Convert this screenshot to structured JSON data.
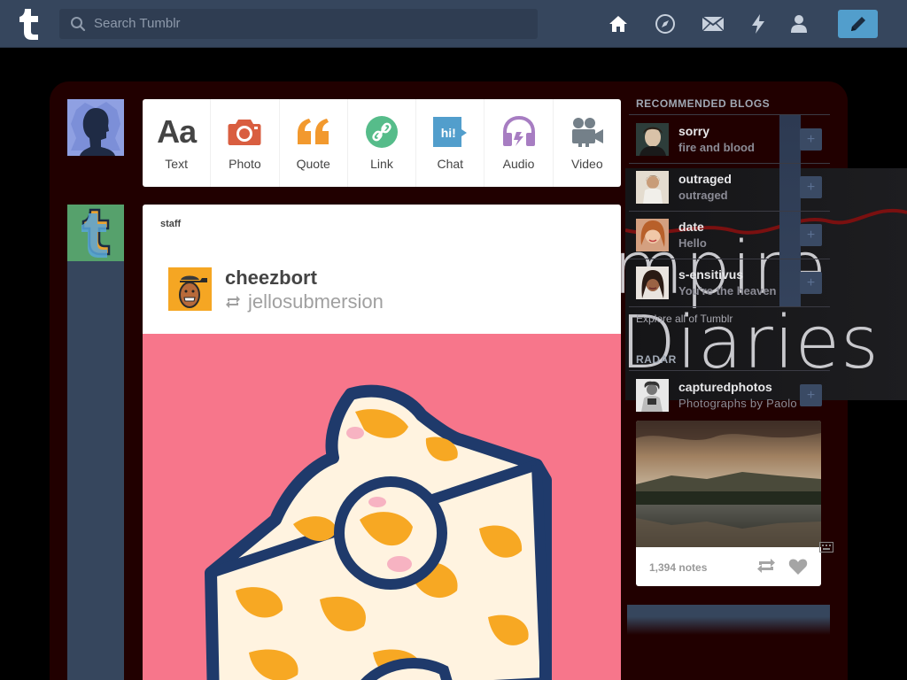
{
  "colors": {
    "topbar": "#36465d",
    "compose": "#529ecc",
    "frame": "#210000",
    "post_art": "#f7768b",
    "quote_orange": "#f2992e",
    "link_green": "#56bc8a",
    "chat_blue": "#529ecc",
    "audio_purple": "#a77dc2",
    "photo_red": "#d95e40"
  },
  "header": {
    "search_placeholder": "Search Tumblr",
    "icons": [
      "tumblr-logo",
      "search-icon",
      "home-icon",
      "explore-icon",
      "inbox-icon",
      "activity-icon",
      "account-icon",
      "compose-icon"
    ]
  },
  "post_types": [
    {
      "label": "Text",
      "icon": "text-icon"
    },
    {
      "label": "Photo",
      "icon": "camera-icon"
    },
    {
      "label": "Quote",
      "icon": "quote-icon"
    },
    {
      "label": "Link",
      "icon": "link-icon"
    },
    {
      "label": "Chat",
      "icon": "chat-icon",
      "glyph": "hi!"
    },
    {
      "label": "Audio",
      "icon": "headphones-icon"
    },
    {
      "label": "Video",
      "icon": "video-camera-icon"
    }
  ],
  "post": {
    "author": "staff",
    "reblogger": "cheezbort",
    "source": "jellosubmersion"
  },
  "background": {
    "line1": "mpire",
    "line2": "Diaries"
  },
  "sidebar": {
    "recommended_heading": "RECOMMENDED BLOGS",
    "blogs": [
      {
        "name": "sorry",
        "desc": "fire and blood"
      },
      {
        "name": "outraged",
        "desc": "outraged"
      },
      {
        "name": "date",
        "desc": "Hello"
      },
      {
        "name": "s-ensitivus",
        "desc": "You're the heaven"
      }
    ],
    "follow_glyph": "+",
    "explore_link": "Explore all of Tumblr",
    "radar_heading": "RADAR",
    "radar": {
      "name": "capturedphotos",
      "desc": "Photographs by Paolo",
      "notes": "1,394 notes"
    }
  }
}
